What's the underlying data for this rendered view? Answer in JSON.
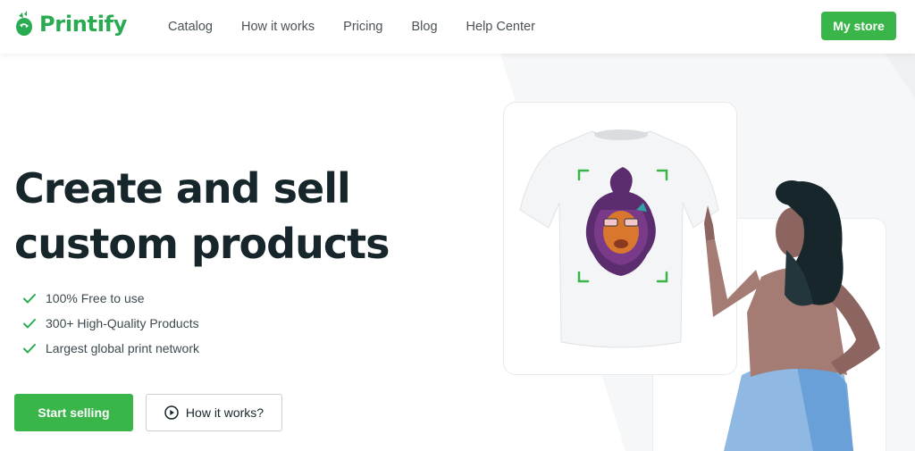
{
  "brand": {
    "name": "Printify",
    "color": "#29ab51"
  },
  "nav": {
    "items": [
      {
        "label": "Catalog"
      },
      {
        "label": "How it works"
      },
      {
        "label": "Pricing"
      },
      {
        "label": "Blog"
      },
      {
        "label": "Help Center"
      }
    ],
    "store_button": "My store"
  },
  "hero": {
    "headline_line1": "Create and sell",
    "headline_line2": "custom products",
    "features": [
      {
        "text": "100% Free to use",
        "icon": "check-icon"
      },
      {
        "text": "300+ High-Quality Products",
        "icon": "check-icon"
      },
      {
        "text": "Largest global print network",
        "icon": "check-icon"
      }
    ],
    "primary_cta": "Start selling",
    "secondary_cta": "How it works?",
    "secondary_cta_icon": "play-circle-icon"
  },
  "illustration": {
    "product": "t-shirt-mockup",
    "design": "lion-graphic",
    "accent": "#39b54a"
  }
}
